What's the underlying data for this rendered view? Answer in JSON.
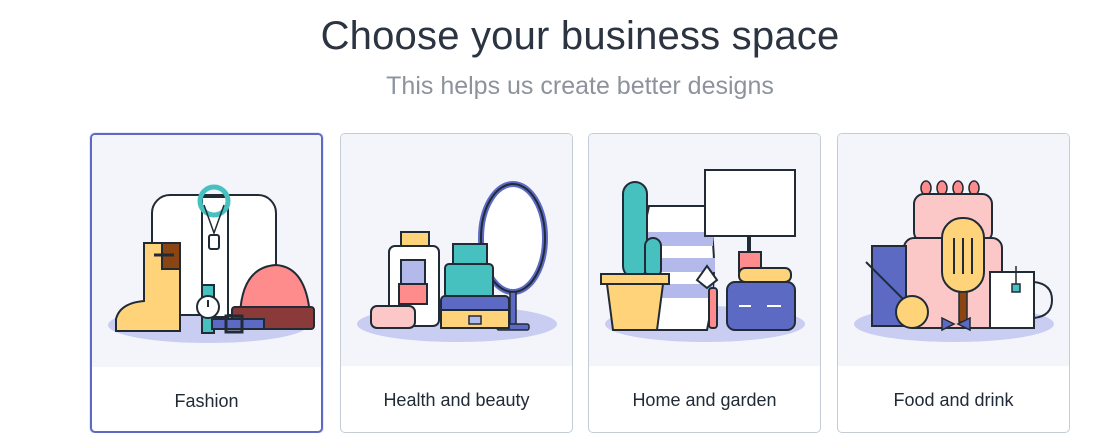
{
  "header": {
    "title": "Choose your business space",
    "subtitle": "This helps us create better designs"
  },
  "categories": [
    {
      "label": "Fashion",
      "selected": true
    },
    {
      "label": "Health and beauty",
      "selected": false
    },
    {
      "label": "Home and garden",
      "selected": false
    },
    {
      "label": "Food and drink",
      "selected": false
    }
  ],
  "colors": {
    "accent": "#5c6ac4",
    "outline": "#212b36",
    "illustration_bg": "#f4f5fb",
    "shadow_ellipse": "#c9cdf2",
    "salmon": "#ff8c8c",
    "teal": "#47c1bf",
    "yellow": "#ffe08a",
    "indigo": "#5c6ac4"
  },
  "icons": [
    "fashion-illustration",
    "health-beauty-illustration",
    "home-garden-illustration",
    "food-drink-illustration"
  ]
}
